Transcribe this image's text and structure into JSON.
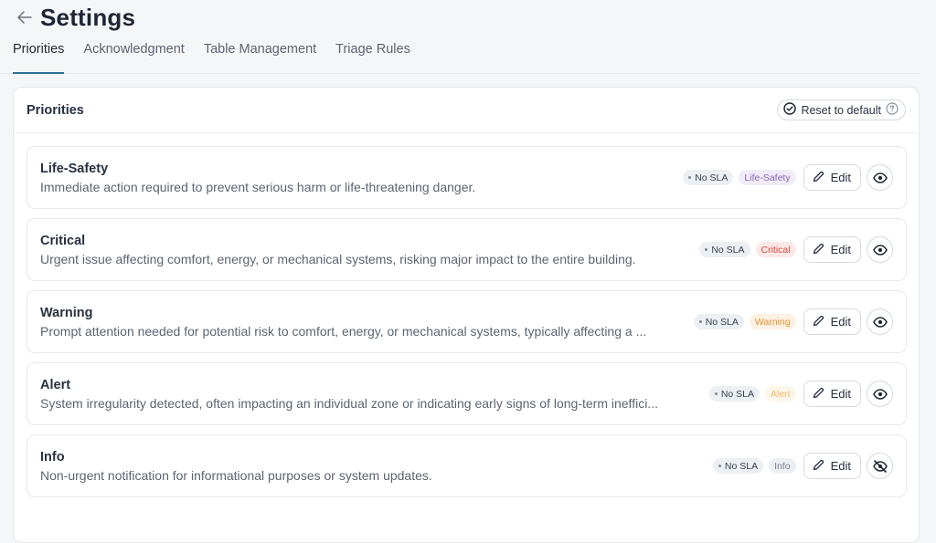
{
  "header": {
    "title": "Settings",
    "back_icon": "arrow-left-icon"
  },
  "tabs": [
    {
      "label": "Priorities",
      "active": true
    },
    {
      "label": "Acknowledgment",
      "active": false
    },
    {
      "label": "Table Management",
      "active": false
    },
    {
      "label": "Triage Rules",
      "active": false
    }
  ],
  "card": {
    "title": "Priorities",
    "reset_label": "Reset to default"
  },
  "priorities": [
    {
      "name": "Life-Safety",
      "description": "Immediate action required to prevent serious harm or life-threatening danger.",
      "sla": "No SLA",
      "tag": "Life-Safety",
      "tag_bg": "#f1ecf8",
      "tag_fg": "#8a63b8",
      "edit": "Edit",
      "visible": true
    },
    {
      "name": "Critical",
      "description": "Urgent issue affecting comfort, energy, or mechanical systems, risking major impact to the entire building.",
      "sla": "No SLA",
      "tag": "Critical",
      "tag_bg": "#fde8e8",
      "tag_fg": "#d4483f",
      "edit": "Edit",
      "visible": true
    },
    {
      "name": "Warning",
      "description": "Prompt attention needed for potential risk to comfort, energy, or mechanical systems, typically affecting a ...",
      "sla": "No SLA",
      "tag": "Warning",
      "tag_bg": "#fdf1e3",
      "tag_fg": "#e49434",
      "edit": "Edit",
      "visible": true
    },
    {
      "name": "Alert",
      "description": "System irregularity detected, often impacting an individual zone or indicating early signs of long-term ineffici...",
      "sla": "No SLA",
      "tag": "Alert",
      "tag_bg": "#fdf6ea",
      "tag_fg": "#f0b96a",
      "edit": "Edit",
      "visible": true
    },
    {
      "name": "Info",
      "description": "Non-urgent notification for informational purposes or system updates.",
      "sla": "No SLA",
      "tag": "Info",
      "tag_bg": "#eceff3",
      "tag_fg": "#7c8593",
      "edit": "Edit",
      "visible": false
    }
  ],
  "colors": {
    "accent": "#2e6f96",
    "text_primary": "#273142",
    "text_secondary": "#5b6472"
  }
}
